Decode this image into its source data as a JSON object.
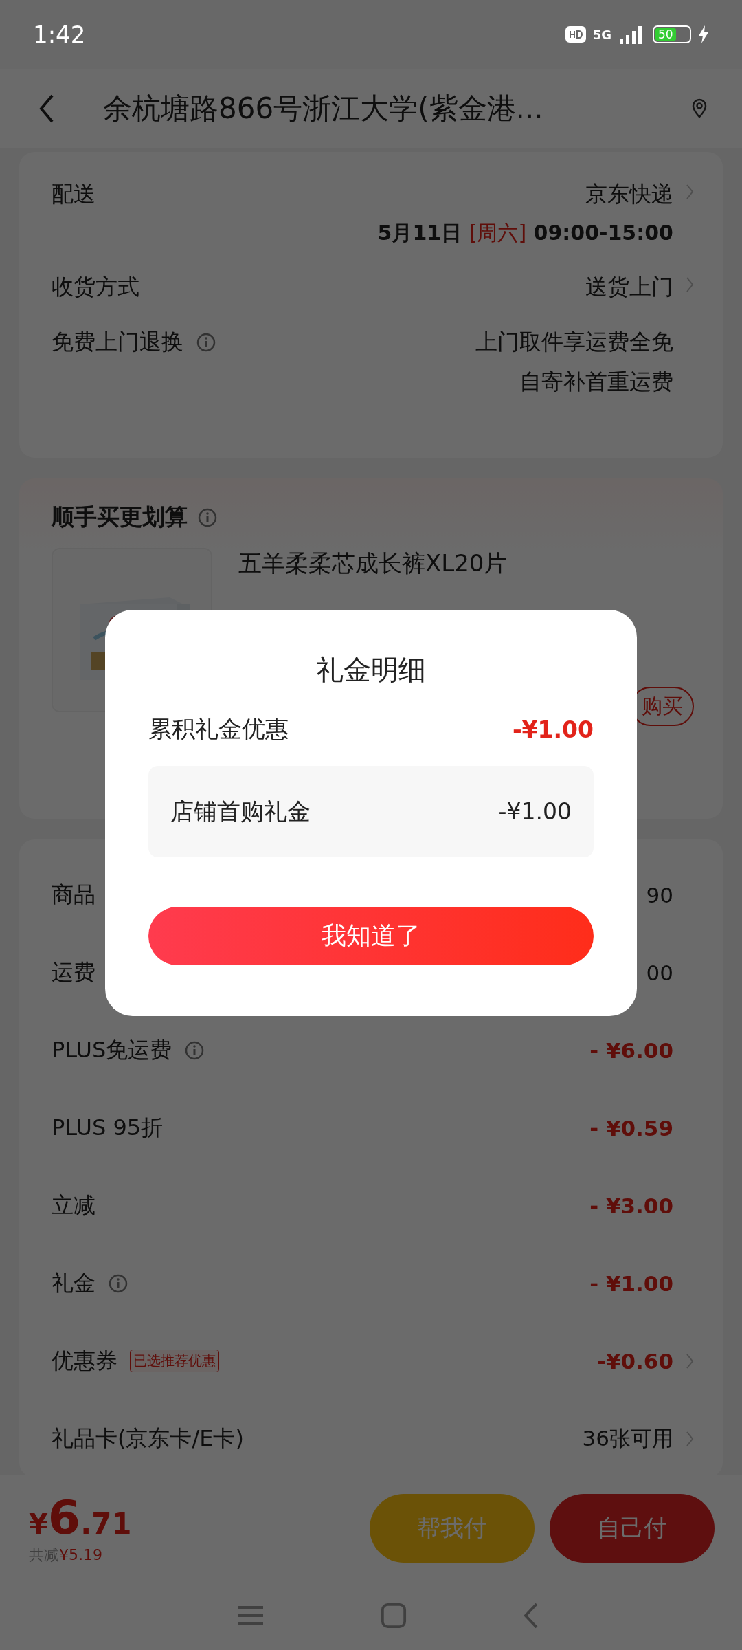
{
  "status_bar": {
    "time": "1:42",
    "network": "5G",
    "battery": "50",
    "charging": true
  },
  "header": {
    "title": "余杭塘路866号浙江大学(紫金港..."
  },
  "delivery": {
    "rows": [
      {
        "kind": "delivery",
        "label": "配送",
        "value": "京东快递",
        "date": "5月11日",
        "weekday": "[周六]",
        "time": "09:00-15:00",
        "chevron": true,
        "info": false
      },
      {
        "kind": "plain",
        "label": "收货方式",
        "lines": [
          "送货上门"
        ],
        "chevron": true,
        "info": false
      },
      {
        "kind": "plain",
        "label": "免费上门退换",
        "lines": [
          "上门取件享运费全免",
          "自寄补首重运费"
        ],
        "chevron": false,
        "info": true
      }
    ]
  },
  "addon": {
    "title": "顺手买更划算",
    "info": true,
    "product": {
      "name": "五羊柔柔芯成长裤XL20片",
      "button": "购买"
    }
  },
  "summary": {
    "rows": [
      {
        "kind": "plain",
        "label": "商品",
        "value": "90"
      },
      {
        "kind": "plain",
        "label": "运费",
        "value": "00"
      },
      {
        "kind": "discount",
        "label": "PLUS免运费",
        "value": "- ¥6.00",
        "info": true,
        "chevron": false
      },
      {
        "kind": "discount",
        "label": "PLUS 95折",
        "value": "- ¥0.59",
        "info": false,
        "chevron": false
      },
      {
        "kind": "discount",
        "label": "立减",
        "value": "- ¥3.00",
        "info": false,
        "chevron": false
      },
      {
        "kind": "discount",
        "label": "礼金",
        "value": "- ¥1.00",
        "info": true,
        "chevron": false
      },
      {
        "kind": "discount",
        "label": "优惠券",
        "tag": "已选推荐优惠",
        "value": "-¥0.60",
        "info": false,
        "chevron": true
      },
      {
        "kind": "plain",
        "label": "礼品卡(京东卡/E卡)",
        "value": "36张可用",
        "info": false,
        "chevron": true
      }
    ]
  },
  "bottom_bar": {
    "currency": "¥",
    "price_integer": "6",
    "price_decimal": ".71",
    "savings_label": "共减",
    "savings": "¥5.19",
    "buttons": [
      {
        "kind": "friend",
        "label": "帮我付"
      },
      {
        "kind": "self",
        "label": "自己付"
      }
    ]
  },
  "dialog": {
    "title": "礼金明细",
    "total_label": "累积礼金优惠",
    "total_value": "-¥1.00",
    "items": [
      {
        "label": "店铺首购礼金",
        "value": "-¥1.00"
      }
    ],
    "button": "我知道了"
  }
}
